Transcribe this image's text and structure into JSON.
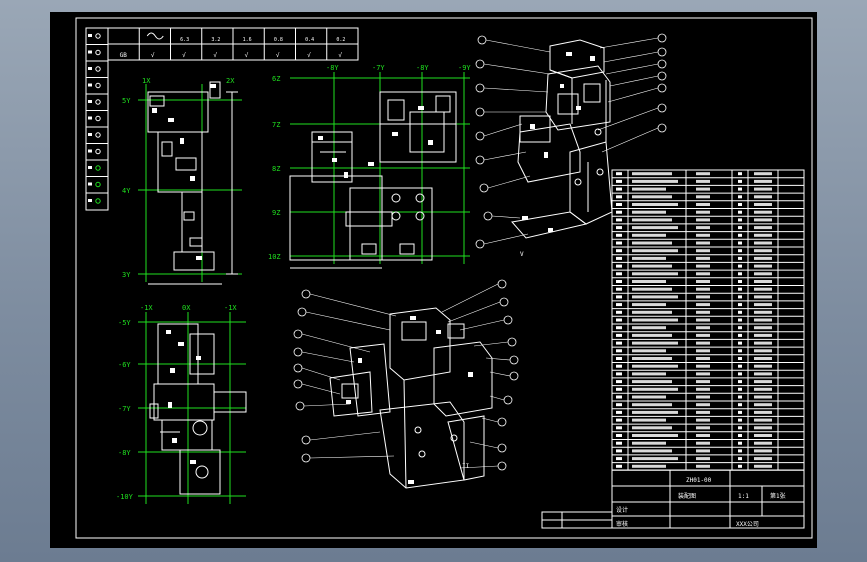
{
  "surface_symbols": [
    "GB",
    "√",
    "√",
    "√",
    "√",
    "√",
    "√",
    "√"
  ],
  "surface_values": [
    "",
    "",
    "6.3",
    "3.2",
    "1.6",
    "0.8",
    "0.4",
    "0.2"
  ],
  "grid_labels_top": [
    "6Z",
    "-8Y",
    "-7Y",
    "-8Y",
    "-9Y"
  ],
  "grid_labels_left_b": [
    "7Z",
    "8Z",
    "9Z",
    "10Z"
  ],
  "grid_labels_a": [
    "1X",
    "2X",
    "5Y",
    "4Y",
    "3Y"
  ],
  "grid_labels_c_top": [
    "-1X",
    "0X",
    "-1X"
  ],
  "grid_labels_c_left": [
    "-5Y",
    "-6Y",
    "-7Y",
    "-8Y",
    "-9Y",
    "-10Y"
  ],
  "view_label_iso1": "V",
  "view_label_iso2": "II",
  "title_block": {
    "row1": "ZH01-00",
    "row2": "装配图",
    "row3": "1:1",
    "sheet": "第1张",
    "company": "XXX公司",
    "drawer": "设计",
    "checker": "审核"
  },
  "colors": {
    "background": "#000000",
    "line": "#ffffff",
    "grid": "#1fe01f"
  }
}
